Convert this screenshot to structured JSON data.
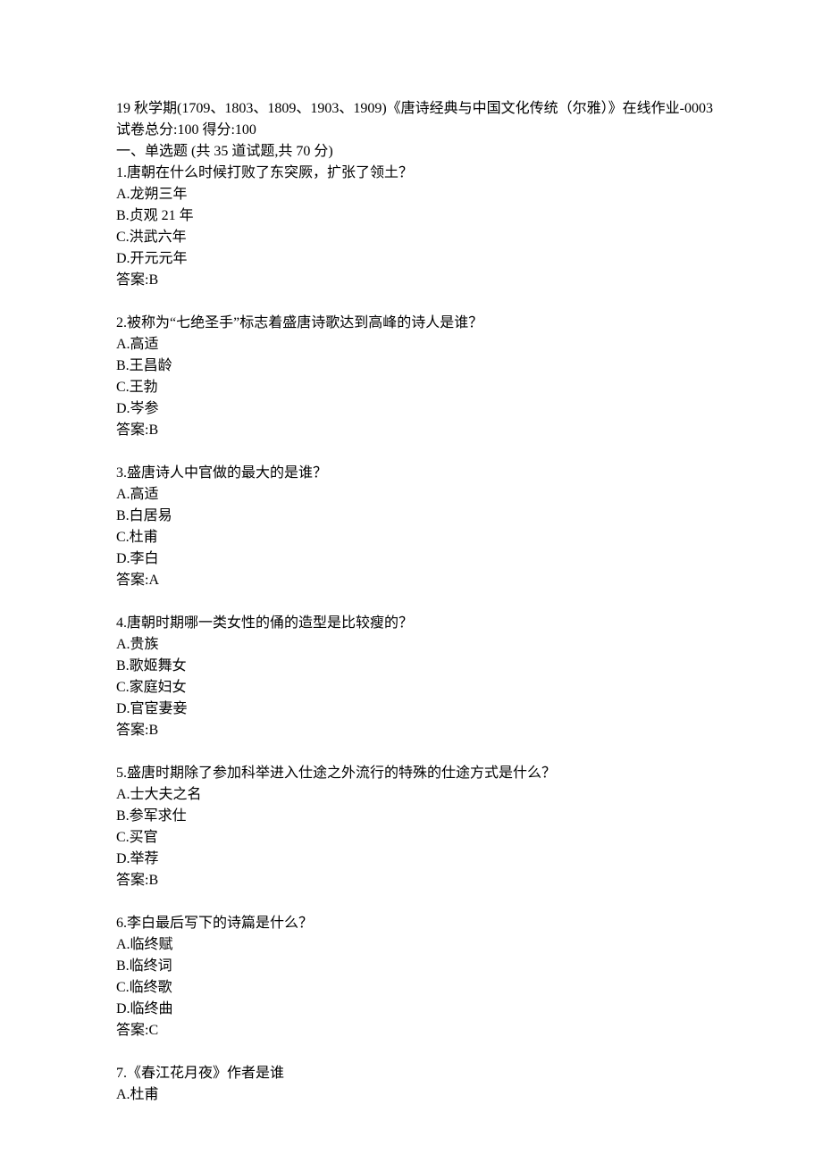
{
  "header": {
    "title": "19 秋学期(1709、1803、1809、1903、1909)《唐诗经典与中国文化传统（尔雅）》在线作业-0003",
    "score_line": "试卷总分:100   得分:100"
  },
  "section": {
    "heading": "一、单选题 (共 35 道试题,共 70 分)"
  },
  "questions": [
    {
      "num": "1.",
      "text": "唐朝在什么时候打败了东突厥，扩张了领土？",
      "options": [
        "A.龙朔三年",
        "B.贞观 21 年",
        "C.洪武六年",
        "D.开元元年"
      ],
      "answer": "答案:B"
    },
    {
      "num": "2.",
      "text": "被称为“七绝圣手”标志着盛唐诗歌达到高峰的诗人是谁？",
      "options": [
        "A.高适",
        "B.王昌龄",
        "C.王勃",
        "D.岑参"
      ],
      "answer": "答案:B"
    },
    {
      "num": "3.",
      "text": "盛唐诗人中官做的最大的是谁？",
      "options": [
        "A.高适",
        "B.白居易",
        "C.杜甫",
        "D.李白"
      ],
      "answer": "答案:A"
    },
    {
      "num": "4.",
      "text": "唐朝时期哪一类女性的俑的造型是比较瘦的？",
      "options": [
        "A.贵族",
        "B.歌姬舞女",
        "C.家庭妇女",
        "D.官宦妻妾"
      ],
      "answer": "答案:B"
    },
    {
      "num": "5.",
      "text": "盛唐时期除了参加科举进入仕途之外流行的特殊的仕途方式是什么？",
      "options": [
        "A.士大夫之名",
        "B.参军求仕",
        "C.买官",
        "D.举荐"
      ],
      "answer": "答案:B"
    },
    {
      "num": "6.",
      "text": "李白最后写下的诗篇是什么？",
      "options": [
        "A.临终赋",
        "B.临终词",
        "C.临终歌",
        "D.临终曲"
      ],
      "answer": "答案:C"
    },
    {
      "num": "7.",
      "text": "《春江花月夜》作者是谁",
      "options": [
        "A.杜甫"
      ],
      "answer": ""
    }
  ]
}
